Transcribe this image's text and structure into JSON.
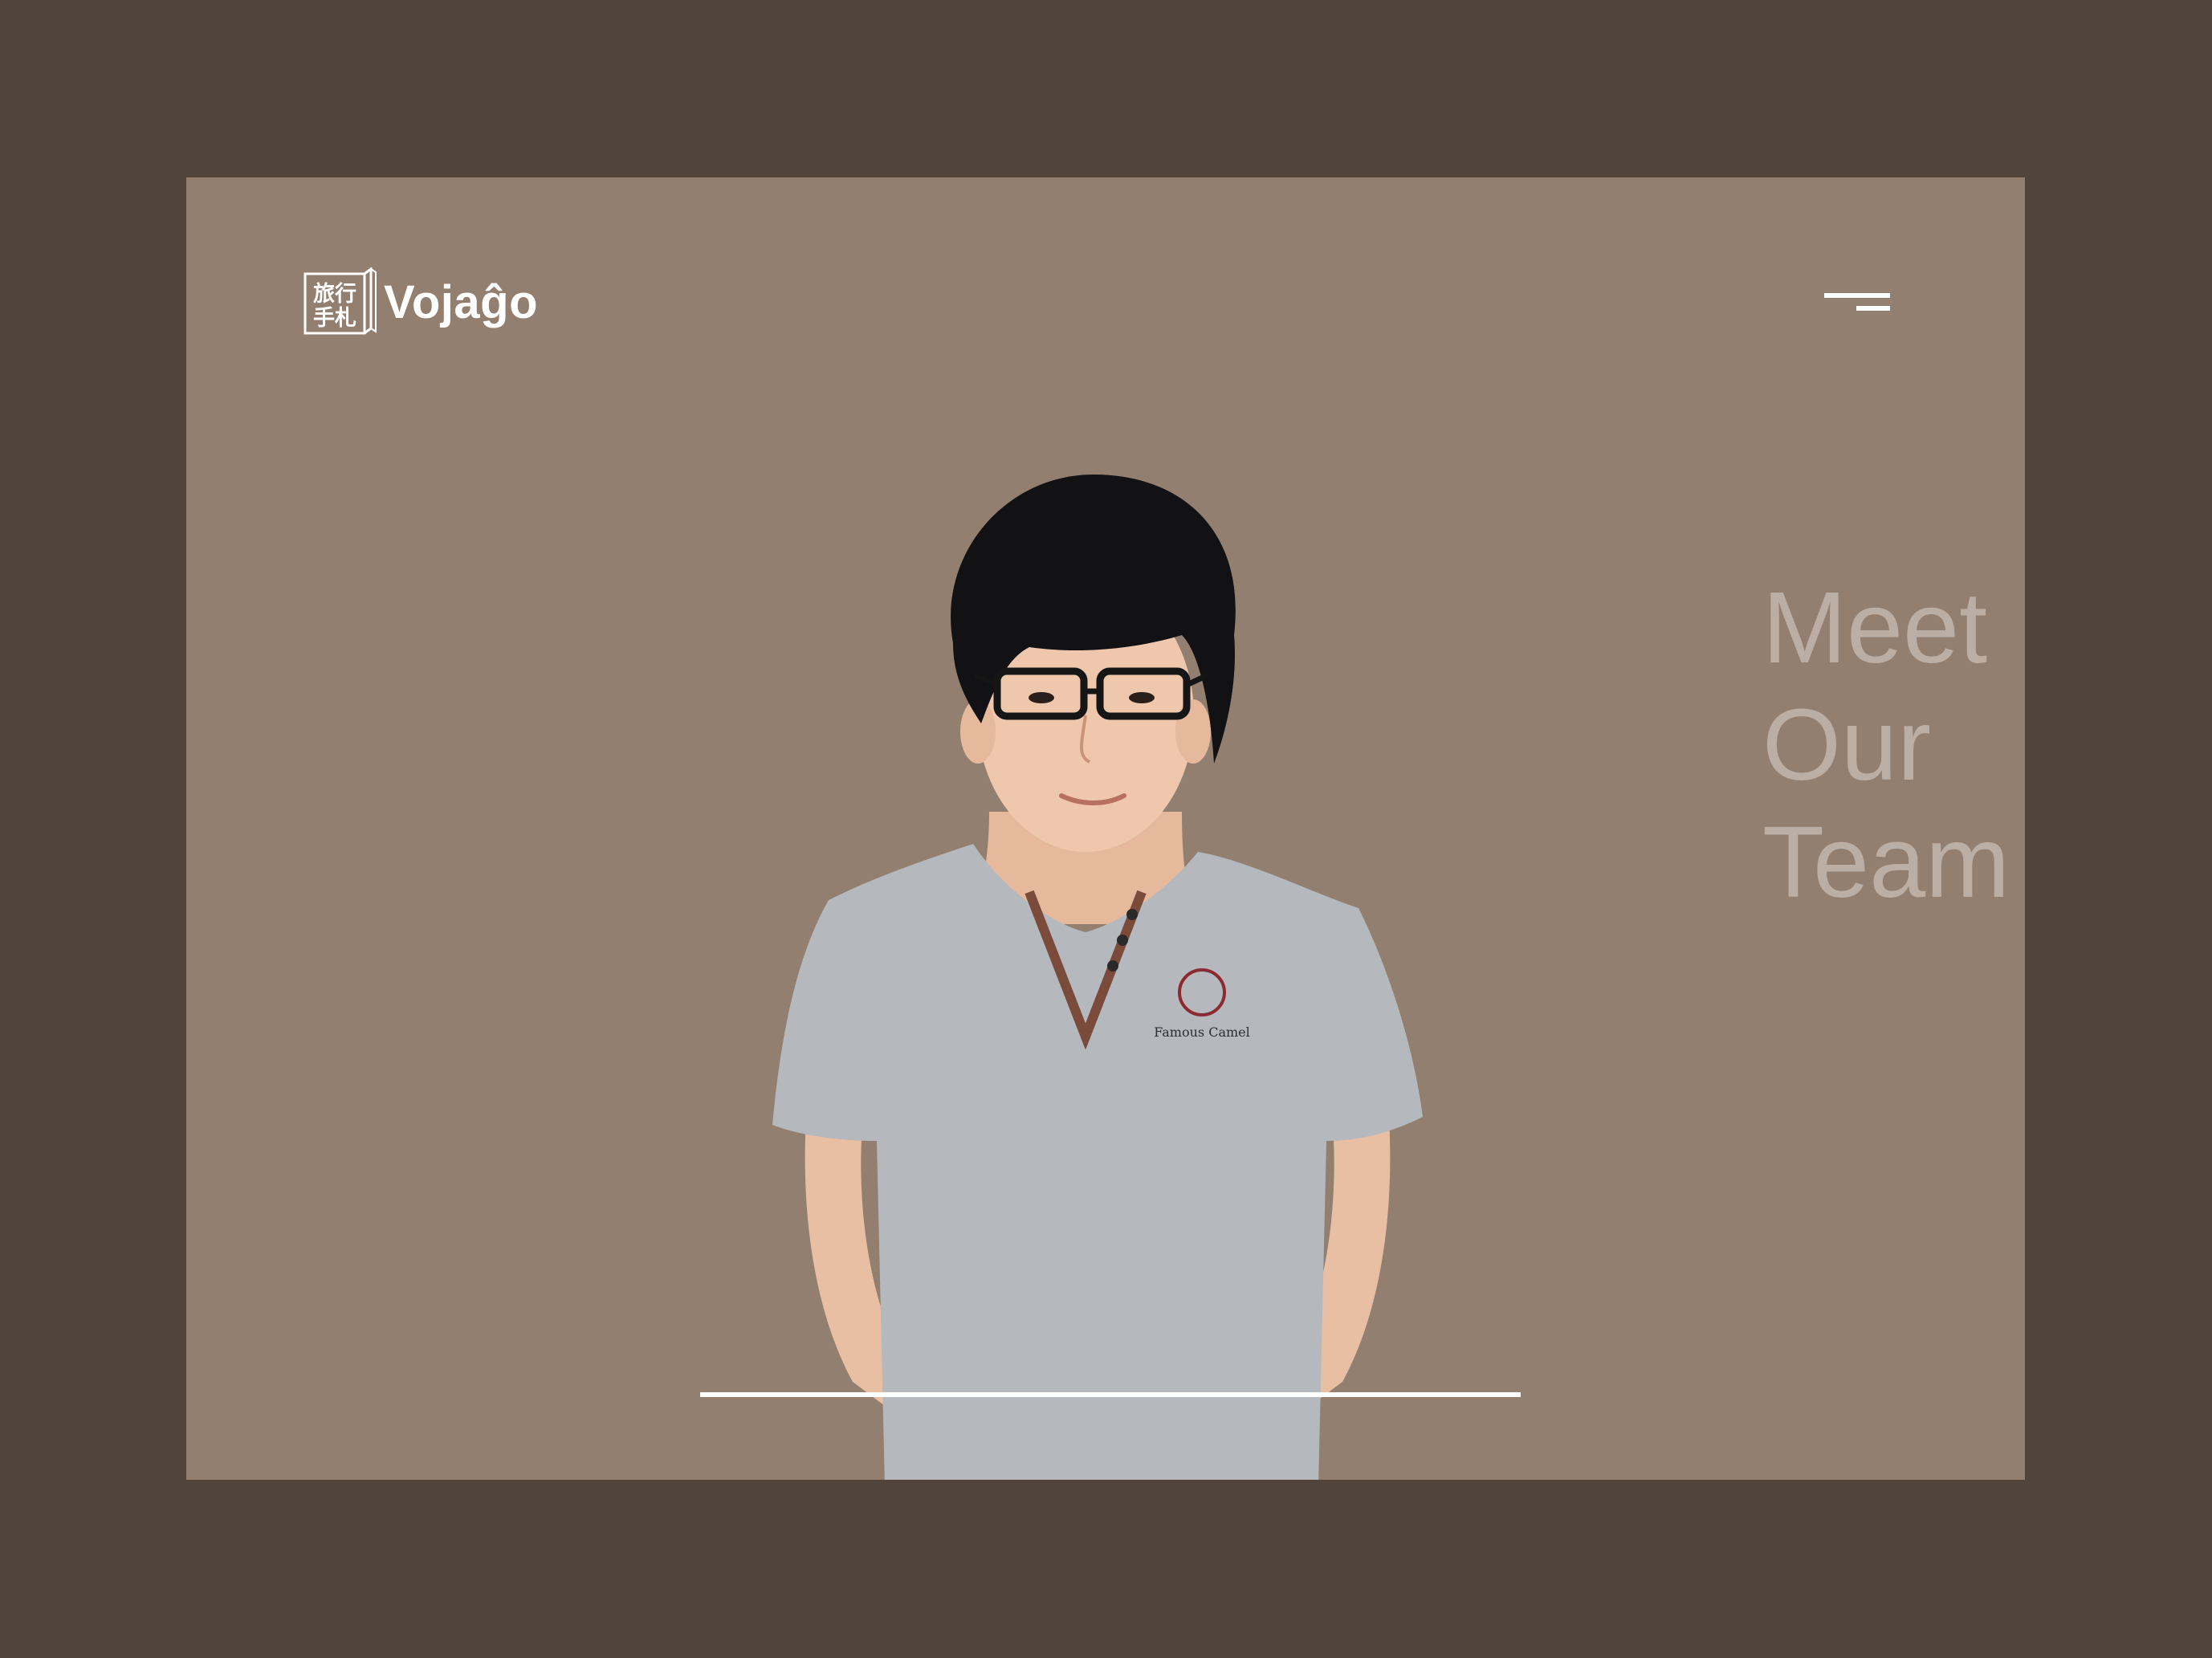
{
  "brand": {
    "name": "Vojaĝo",
    "mark_text": [
      "旅行",
      "手札"
    ],
    "logo_icon": "notebook-logo-icon"
  },
  "menu": {
    "icon": "hamburger-menu-icon"
  },
  "hero": {
    "heading_lines": [
      "Meet",
      "Our",
      "Team"
    ],
    "photo_icon": "team-member-photo",
    "shirt_text": "Famous Camel"
  },
  "colors": {
    "outer_background": "#51453b",
    "card_background": "#937f70",
    "heading_text": "#bbaea4",
    "accent": "#ffffff"
  }
}
